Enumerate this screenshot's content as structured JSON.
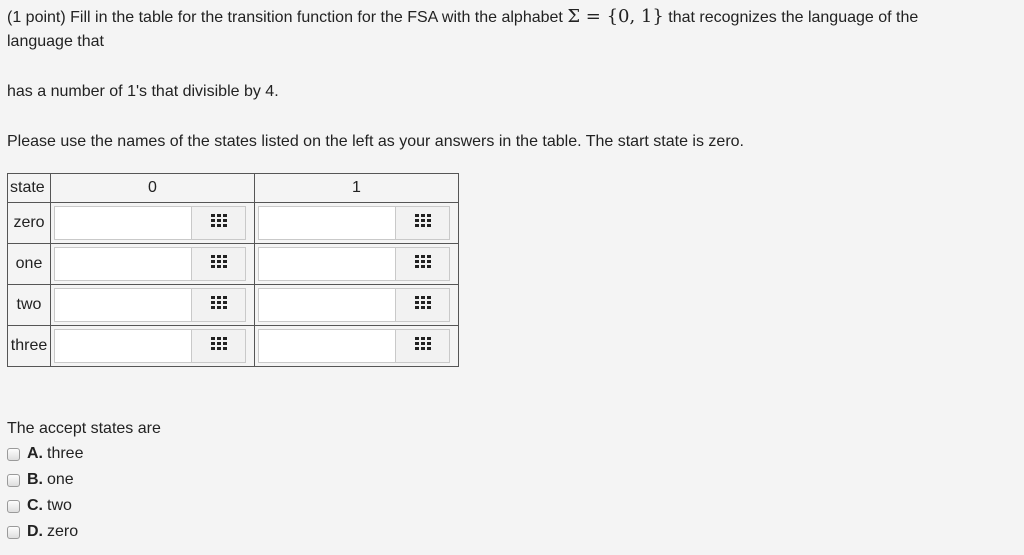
{
  "question": {
    "line1_prefix": "(1 point) Fill in the table for the transition function for the FSA with the alphabet",
    "alphabet_math": "Σ = {0, 1}",
    "line1_suffix": "that recognizes the language of the",
    "line2": "language that",
    "line3": "has a number of 1's that divisible by 4.",
    "line4": "Please use the names of the states listed on the left as your answers in the table. The start state is zero."
  },
  "table": {
    "header_state": "state",
    "header_col0": "0",
    "header_col1": "1",
    "rows": [
      {
        "label": "zero",
        "val0": "",
        "val1": ""
      },
      {
        "label": "one",
        "val0": "",
        "val1": ""
      },
      {
        "label": "two",
        "val0": "",
        "val1": ""
      },
      {
        "label": "three",
        "val0": "",
        "val1": ""
      }
    ],
    "picker_icon": "grid-icon"
  },
  "accept": {
    "prompt": "The accept states are",
    "options": [
      {
        "letter": "A.",
        "text": "three",
        "checked": false
      },
      {
        "letter": "B.",
        "text": "one",
        "checked": false
      },
      {
        "letter": "C.",
        "text": "two",
        "checked": false
      },
      {
        "letter": "D.",
        "text": "zero",
        "checked": false
      }
    ]
  }
}
